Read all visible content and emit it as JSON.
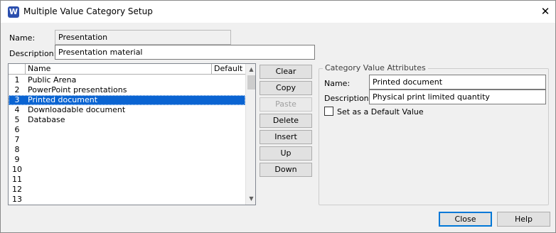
{
  "window": {
    "title": "Multiple Value Category Setup",
    "app_icon_letter": "W",
    "close_glyph": "✕"
  },
  "category": {
    "name_label": "Name:",
    "name_value": "Presentation",
    "description_label": "Description:",
    "description_value": "Presentation material"
  },
  "grid": {
    "columns": [
      "Name",
      "Default"
    ],
    "rows": [
      {
        "num": "1",
        "name": "Public Arena",
        "selected": false
      },
      {
        "num": "2",
        "name": "PowerPoint presentations",
        "selected": false
      },
      {
        "num": "3",
        "name": "Printed document",
        "selected": true
      },
      {
        "num": "4",
        "name": "Downloadable document",
        "selected": false
      },
      {
        "num": "5",
        "name": "Database",
        "selected": false
      },
      {
        "num": "6",
        "name": "",
        "selected": false
      },
      {
        "num": "7",
        "name": "",
        "selected": false
      },
      {
        "num": "8",
        "name": "",
        "selected": false
      },
      {
        "num": "9",
        "name": "",
        "selected": false
      },
      {
        "num": "10",
        "name": "",
        "selected": false
      },
      {
        "num": "11",
        "name": "",
        "selected": false
      },
      {
        "num": "12",
        "name": "",
        "selected": false
      },
      {
        "num": "13",
        "name": "",
        "selected": false
      }
    ],
    "scroll_up_glyph": "▲",
    "scroll_down_glyph": "▼"
  },
  "actions": {
    "clear": "Clear",
    "copy": "Copy",
    "paste": "Paste",
    "delete": "Delete",
    "insert": "Insert",
    "up": "Up",
    "down": "Down"
  },
  "attributes": {
    "group_title": "Category Value Attributes",
    "name_label": "Name:",
    "name_value": "Printed document",
    "description_label": "Description:",
    "description_value": "Physical print limited quantity",
    "default_checkbox_label": "Set as a Default Value",
    "default_checked": false
  },
  "footer": {
    "close": "Close",
    "help": "Help"
  },
  "colors": {
    "selection": "#0a64d2",
    "focus_border": "#0078d7"
  }
}
